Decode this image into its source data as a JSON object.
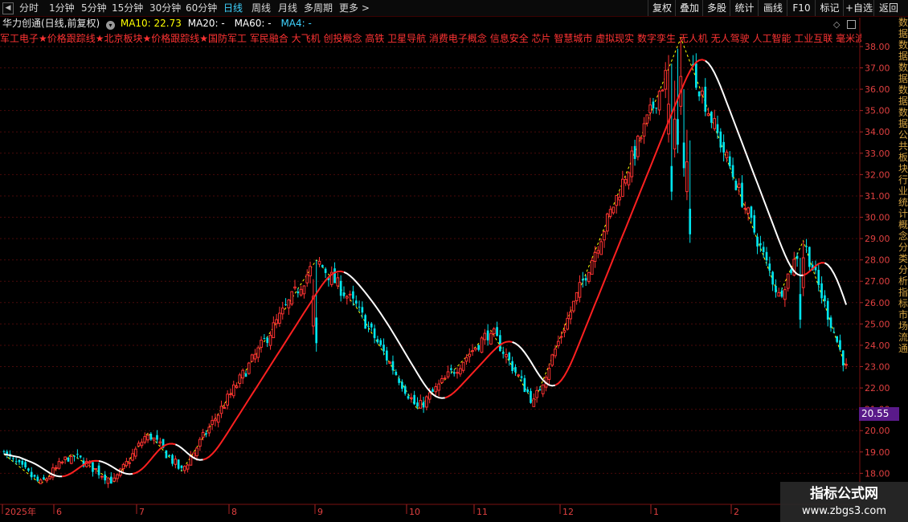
{
  "toolbar": {
    "periods": [
      "分时",
      "1分钟",
      "5分钟",
      "15分钟",
      "30分钟",
      "60分钟",
      "日线",
      "周线",
      "月线",
      "多周期",
      "更多"
    ],
    "active_period": "日线",
    "more_arrow": ">",
    "right_buttons": [
      "复权",
      "叠加",
      "多股",
      "统计",
      "画线",
      "F10",
      "标记",
      "+自选",
      "返回"
    ]
  },
  "info": {
    "stock_label": "华力创通(日线,前复权)",
    "ma10_text": "MA10: 22.73",
    "ma20_text": "MA20: -",
    "ma60_text": "MA60: -",
    "ma4_text": "MA4: -",
    "ma10_color": "#ffff00",
    "ma20_color": "#ffffff",
    "ma60_color": "#ff3399",
    "ma4_color": "#ffffff"
  },
  "concepts": "军工电子★价格跟踪线★北京板块★价格跟踪线★国防军工 军民融合 大飞机 创投概念 高铁 卫星导航 消费电子概念 信息安全 芯片 智慧城市 虚拟现实 数字孪生 无人机 无人驾驶 人工智能 工业互联 毫米波雷",
  "right_strip_text": "数据数据数据数据数据公共板块行业统计概念分类分析指标市场流通",
  "price_badge": "20.55",
  "watermark": {
    "title": "指标公式网",
    "url": "www.zbgs3.com"
  },
  "chart_data": {
    "type": "candlestick",
    "y_ticks": [
      "18.00",
      "19.00",
      "20.00",
      "21.00",
      "22.00",
      "23.00",
      "24.00",
      "25.00",
      "26.00",
      "27.00",
      "28.00",
      "29.00",
      "30.00",
      "31.00",
      "32.00",
      "33.00",
      "34.00",
      "35.00",
      "36.00",
      "37.00",
      "38.00"
    ],
    "ylim": [
      17.6,
      38.5
    ],
    "x_labels": [
      "2025年",
      "6",
      "7",
      "8",
      "9",
      "10",
      "11",
      "12",
      "1",
      "2"
    ],
    "up_color": "#ff3232",
    "down_color": "#00e5ee",
    "ma_short_color": "#ffffff",
    "ma_long_color": "#ff2020",
    "zigzag_color": "#ffff00",
    "zigzag_pivots": [
      {
        "i": 0,
        "p": 18.9
      },
      {
        "i": 12,
        "p": 17.5
      },
      {
        "i": 22,
        "p": 18.9
      },
      {
        "i": 36,
        "p": 17.6
      },
      {
        "i": 47,
        "p": 19.9
      },
      {
        "i": 58,
        "p": 18.1
      },
      {
        "i": 102,
        "p": 28.0
      },
      {
        "i": 115,
        "p": 25.8
      },
      {
        "i": 135,
        "p": 21.0
      },
      {
        "i": 159,
        "p": 24.7
      },
      {
        "i": 173,
        "p": 21.3
      },
      {
        "i": 221,
        "p": 38.4
      },
      {
        "i": 253,
        "p": 26.3
      },
      {
        "i": 261,
        "p": 28.9
      },
      {
        "i": 275,
        "p": 22.9
      }
    ]
  }
}
